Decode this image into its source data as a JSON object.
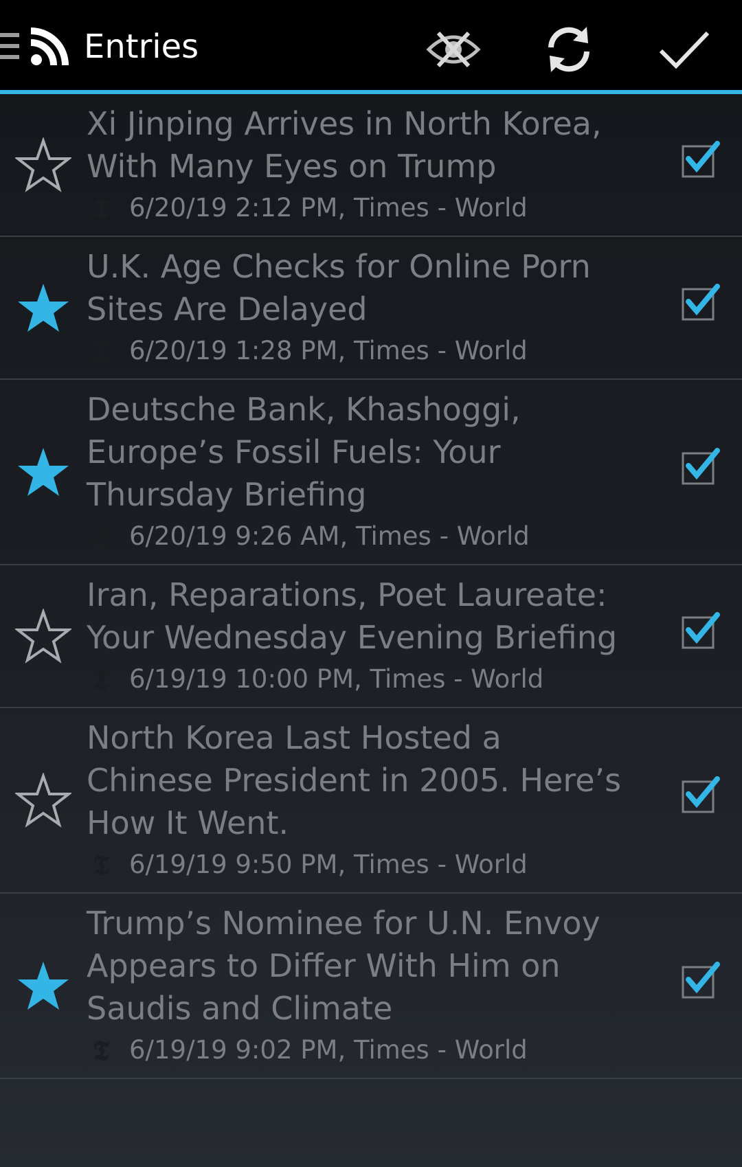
{
  "header": {
    "title": "Entries",
    "icons": [
      "menu-icon",
      "rss-icon",
      "hide-read-icon",
      "refresh-icon",
      "mark-all-read-icon"
    ]
  },
  "colors": {
    "accent": "#33b5e5",
    "bar_background": "#000000",
    "list_text": "#7b7e83"
  },
  "entries": [
    {
      "title_lines": [
        "Xi Jinping Arrives in North Korea,",
        "With Many Eyes on Trump"
      ],
      "meta": "6/20/19 2:12 PM, Times - World",
      "starred": false,
      "checked": true
    },
    {
      "title_lines": [
        "U.K. Age Checks for Online Porn",
        "Sites Are Delayed"
      ],
      "meta": "6/20/19 1:28 PM, Times - World",
      "starred": true,
      "checked": true
    },
    {
      "title_lines": [
        "Deutsche Bank, Khashoggi,",
        "Europe’s Fossil Fuels: Your",
        "Thursday Briefing"
      ],
      "meta": "6/20/19 9:26 AM, Times - World",
      "starred": true,
      "checked": true
    },
    {
      "title_lines": [
        "Iran, Reparations, Poet Laureate:",
        "Your Wednesday Evening Briefing"
      ],
      "meta": "6/19/19 10:00 PM, Times - World",
      "starred": false,
      "checked": true
    },
    {
      "title_lines": [
        "North Korea Last Hosted a",
        "Chinese President in 2005. Here’s",
        "How It Went."
      ],
      "meta": "6/19/19 9:50 PM, Times - World",
      "starred": false,
      "checked": true
    },
    {
      "title_lines": [
        "Trump’s Nominee for U.N. Envoy",
        "Appears to Differ With Him on",
        "Saudis and Climate"
      ],
      "meta": "6/19/19 9:02 PM, Times - World",
      "starred": true,
      "checked": true
    }
  ]
}
